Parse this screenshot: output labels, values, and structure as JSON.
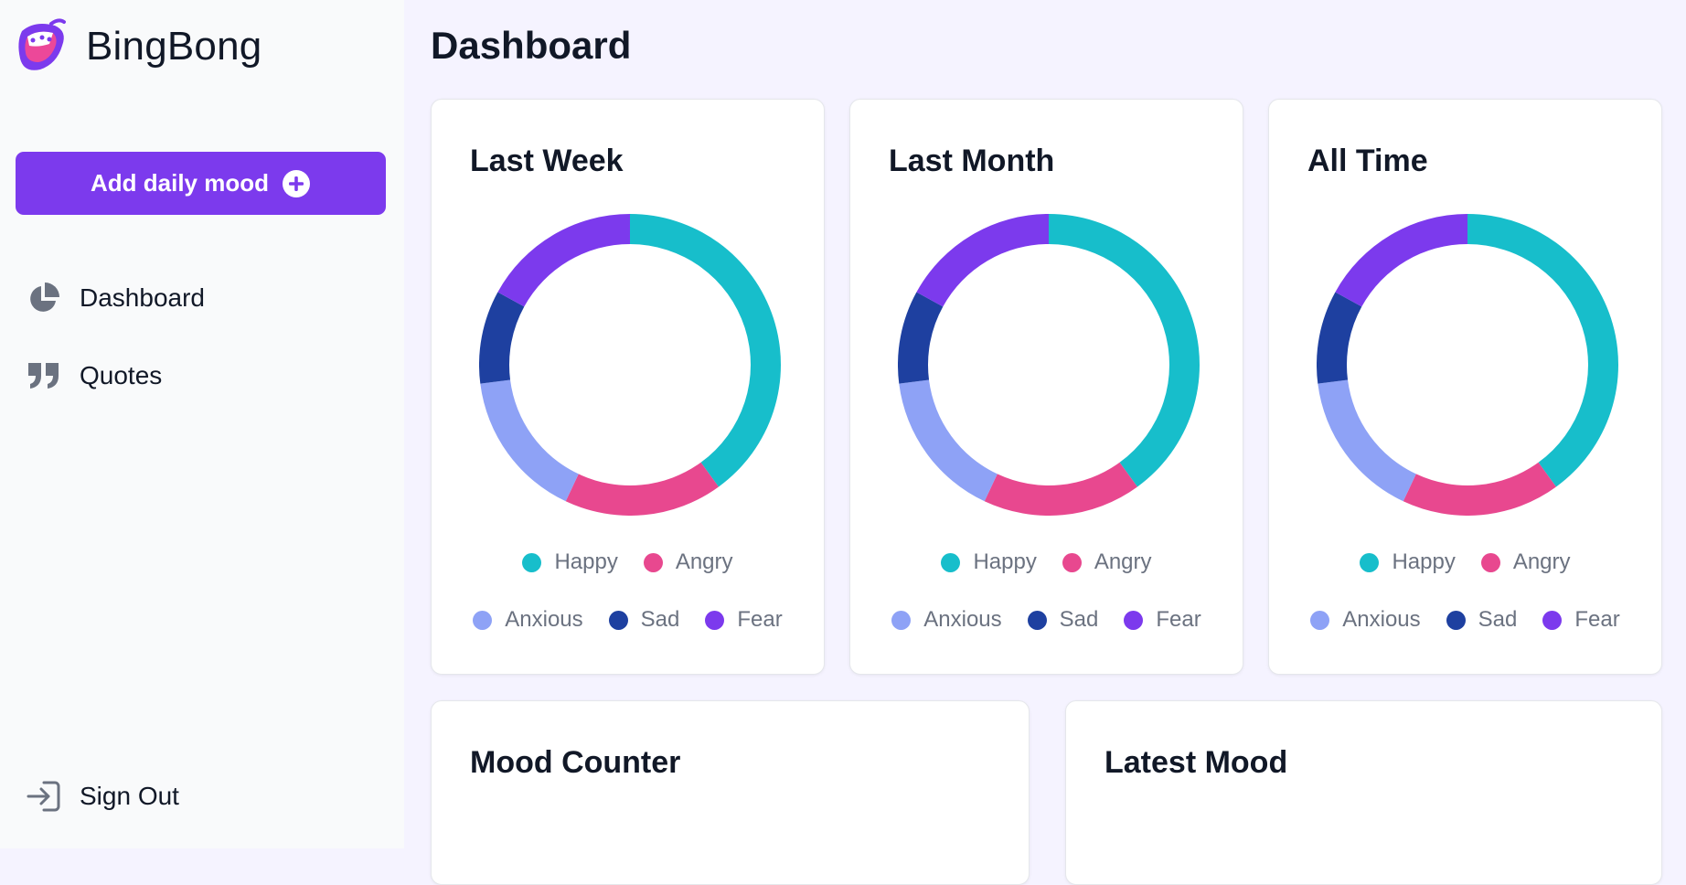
{
  "app": {
    "name": "BingBong"
  },
  "sidebar": {
    "add_button_label": "Add daily mood",
    "nav": [
      {
        "label": "Dashboard",
        "icon": "pie-chart-icon"
      },
      {
        "label": "Quotes",
        "icon": "quote-icon"
      }
    ],
    "sign_out_label": "Sign Out"
  },
  "page": {
    "title": "Dashboard"
  },
  "cards": {
    "week_title": "Last Week",
    "month_title": "Last Month",
    "all_title": "All Time",
    "counter_title": "Mood Counter",
    "latest_title": "Latest Mood"
  },
  "colors": {
    "accent": "#7c3aed",
    "happy": "#17becb",
    "angry": "#e8488f",
    "anxious": "#8ea2f6",
    "sad": "#1e40a0",
    "fear": "#7c3aed"
  },
  "chart_data": [
    {
      "type": "pie",
      "title": "Last Week",
      "categories": [
        "Happy",
        "Angry",
        "Anxious",
        "Sad",
        "Fear"
      ],
      "values": [
        40,
        17,
        16,
        10,
        17
      ],
      "legend": "bottom"
    },
    {
      "type": "pie",
      "title": "Last Month",
      "categories": [
        "Happy",
        "Angry",
        "Anxious",
        "Sad",
        "Fear"
      ],
      "values": [
        40,
        17,
        16,
        10,
        17
      ],
      "legend": "bottom"
    },
    {
      "type": "pie",
      "title": "All Time",
      "categories": [
        "Happy",
        "Angry",
        "Anxious",
        "Sad",
        "Fear"
      ],
      "values": [
        40,
        17,
        16,
        10,
        17
      ],
      "legend": "bottom"
    }
  ]
}
